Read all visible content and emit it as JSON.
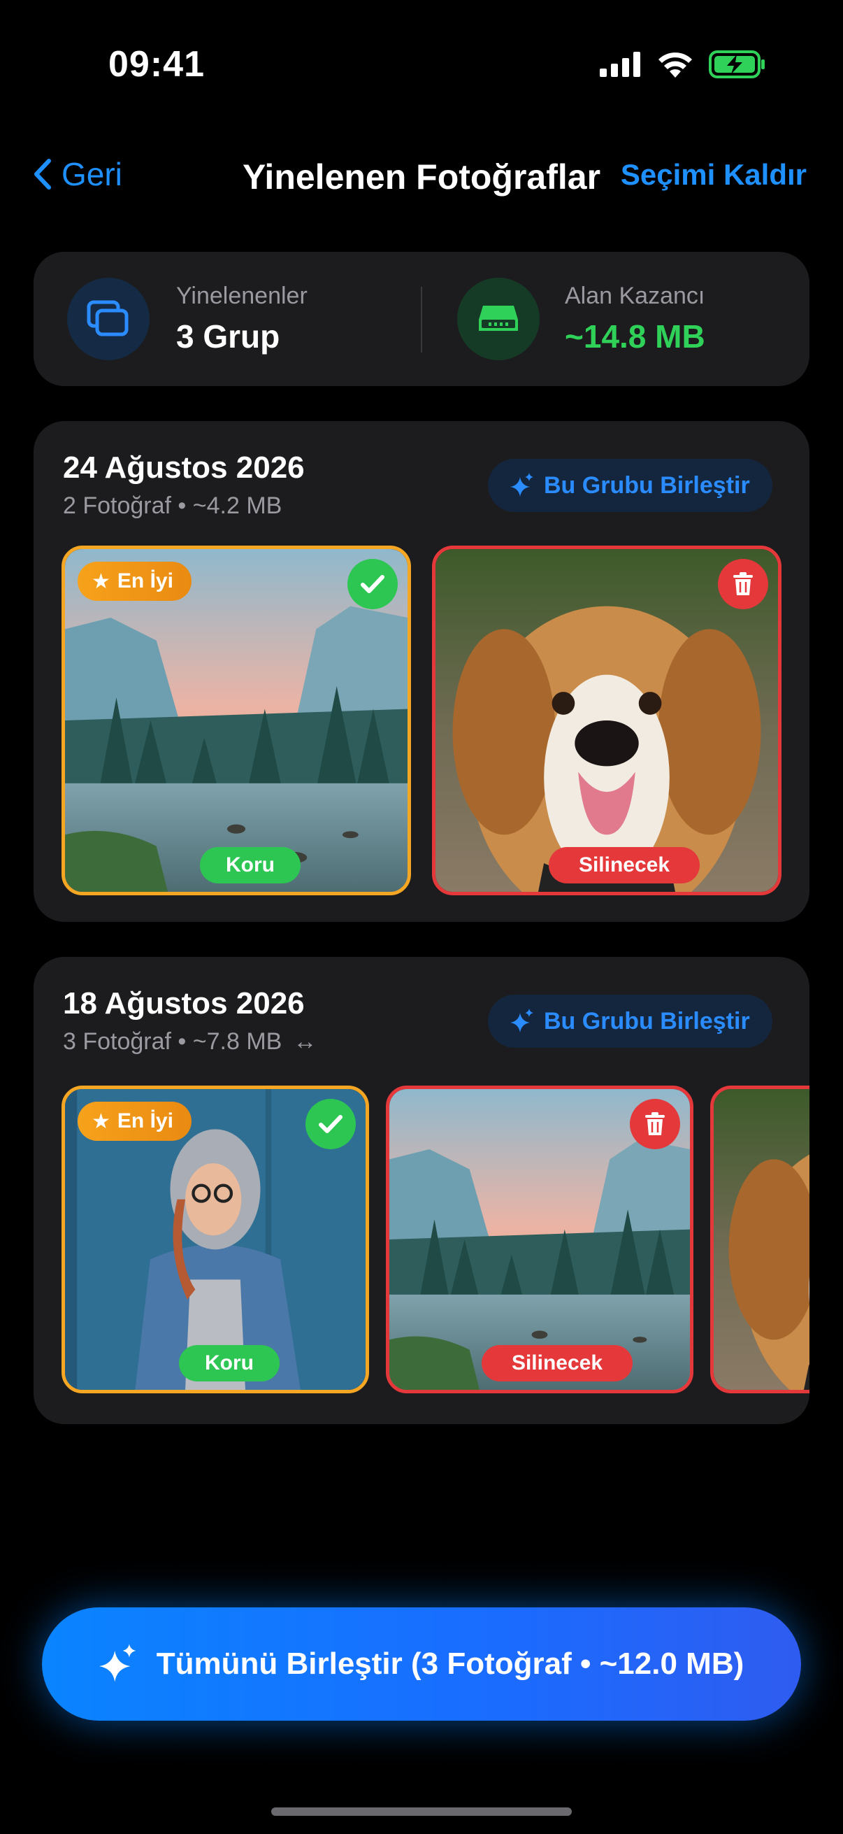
{
  "status": {
    "time": "09:41"
  },
  "nav": {
    "back_label": "Geri",
    "title": "Yinelenen Fotoğraflar",
    "deselect_label": "Seçimi Kaldır"
  },
  "summary": {
    "duplicates_label": "Yinelenenler",
    "duplicates_value": "3 Grup",
    "space_label": "Alan Kazancı",
    "space_value": "~14.8 MB",
    "space_color": "#30d158"
  },
  "groups": [
    {
      "date": "24 Ağustos 2026",
      "meta": "2 Fotoğraf • ~4.2 MB",
      "merge_label": "Bu Grubu Birleştir",
      "photos": [
        {
          "subject": "landscape",
          "best_label": "En İyi",
          "status": "Koru"
        },
        {
          "subject": "dog",
          "status": "Silinecek"
        }
      ]
    },
    {
      "date": "18 Ağustos 2026",
      "meta": "3 Fotoğraf • ~7.8 MB",
      "meta_icon": "↔",
      "merge_label": "Bu Grubu Birleştir",
      "photos": [
        {
          "subject": "person",
          "best_label": "En İyi",
          "status": "Koru"
        },
        {
          "subject": "landscape",
          "status": "Silinecek"
        },
        {
          "subject": "dog",
          "status": ""
        }
      ]
    }
  ],
  "merge_all_label": "Tümünü Birleştir (3 Fotoğraf • ~12.0 MB)",
  "colors": {
    "accent": "#0a84ff",
    "keep": "#2dc653",
    "delete": "#e5383b",
    "best": "#f5a623"
  }
}
